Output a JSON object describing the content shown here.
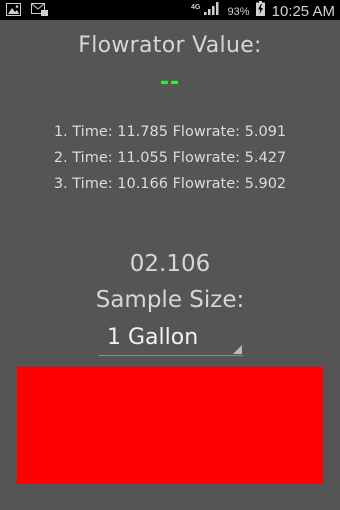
{
  "status_bar": {
    "network_type": "4G",
    "battery_percent": "93%",
    "time": "10:25 AM",
    "icons": [
      "gallery-icon",
      "message-icon",
      "signal-icon",
      "battery-icon"
    ]
  },
  "main": {
    "title": "Flowrator Value:",
    "current_value": "--",
    "current_value_color": "#33ee33",
    "results": [
      "1. Time: 11.785 Flowrate: 5.091",
      "2. Time: 11.055 Flowrate: 5.427",
      "3. Time: 10.166 Flowrate: 5.902"
    ],
    "elapsed": "02.106",
    "sample_label": "Sample Size:",
    "sample_size": {
      "selected": "1 Gallon"
    },
    "action_area_color": "#ff0000"
  }
}
